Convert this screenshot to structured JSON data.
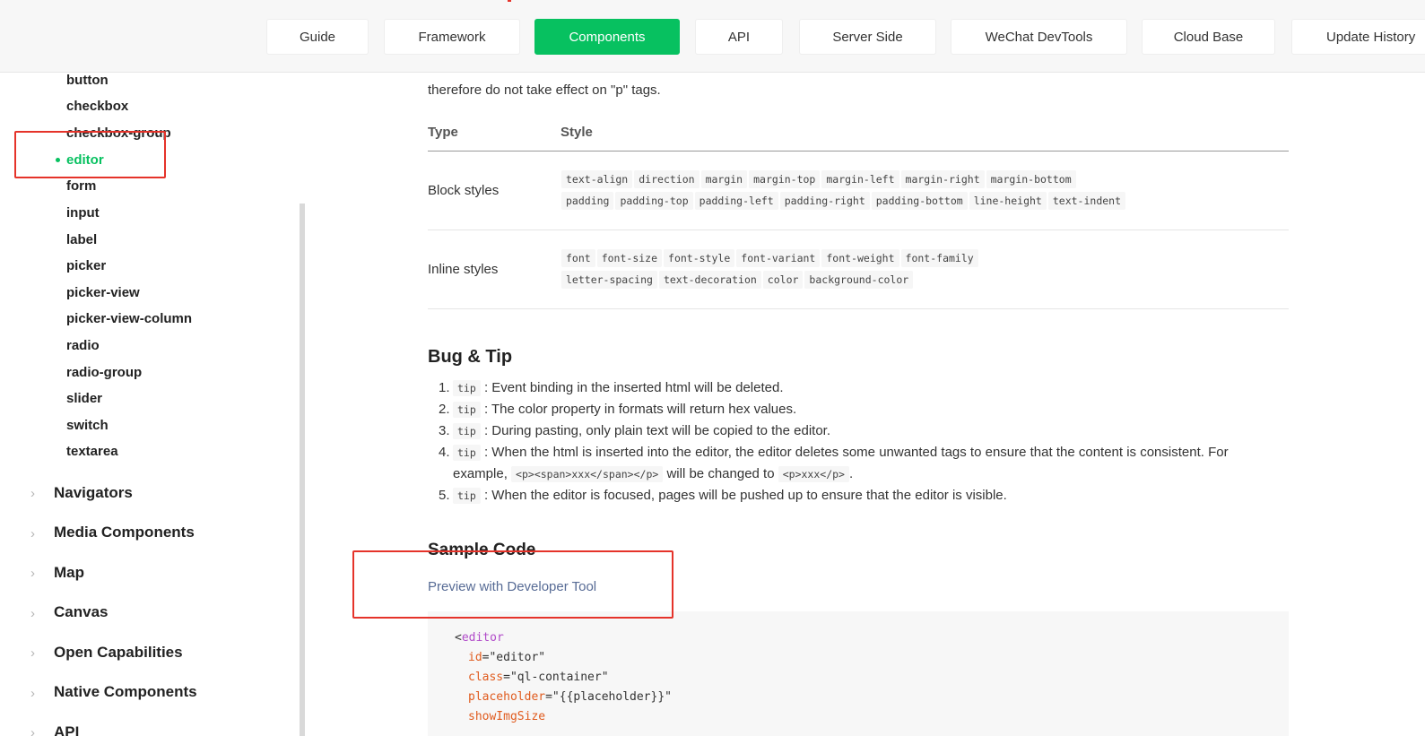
{
  "topnav": {
    "items": [
      {
        "label": "Guide"
      },
      {
        "label": "Framework"
      },
      {
        "label": "Components"
      },
      {
        "label": "API"
      },
      {
        "label": "Server Side"
      },
      {
        "label": "WeChat DevTools"
      },
      {
        "label": "Cloud Base"
      },
      {
        "label": "Update History"
      }
    ],
    "active": "Components"
  },
  "sidebar": {
    "form_items": [
      {
        "label": "button"
      },
      {
        "label": "checkbox"
      },
      {
        "label": "checkbox-group"
      },
      {
        "label": "editor"
      },
      {
        "label": "form"
      },
      {
        "label": "input"
      },
      {
        "label": "label"
      },
      {
        "label": "picker"
      },
      {
        "label": "picker-view"
      },
      {
        "label": "picker-view-column"
      },
      {
        "label": "radio"
      },
      {
        "label": "radio-group"
      },
      {
        "label": "slider"
      },
      {
        "label": "switch"
      },
      {
        "label": "textarea"
      }
    ],
    "active_item": "editor",
    "groups": [
      {
        "label": "Navigators",
        "chevron": "›"
      },
      {
        "label": "Media Components",
        "chevron": "›"
      },
      {
        "label": "Map",
        "chevron": "›"
      },
      {
        "label": "Canvas",
        "chevron": "›"
      },
      {
        "label": "Open Capabilities",
        "chevron": "›"
      },
      {
        "label": "Native Components",
        "chevron": "›"
      },
      {
        "label": "API",
        "chevron": "›"
      }
    ]
  },
  "content": {
    "cut_off_text": "... therefore do not take effect on ... tags.",
    "intro_line": "therefore do not take effect on \"p\" tags.",
    "table": {
      "headers": [
        "Type",
        "Style"
      ],
      "rows": [
        {
          "type": "Block styles",
          "line1": [
            "text-align",
            "direction",
            "margin",
            "margin-top",
            "margin-left",
            "margin-right",
            "margin-bottom"
          ],
          "line2": [
            "padding",
            "padding-top",
            "padding-left",
            "padding-right",
            "padding-bottom",
            "line-height",
            "text-indent"
          ]
        },
        {
          "type": "Inline styles",
          "line1": [
            "font",
            "font-size",
            "font-style",
            "font-variant",
            "font-weight",
            "font-family"
          ],
          "line2": [
            "letter-spacing",
            "text-decoration",
            "color",
            "background-color"
          ]
        }
      ]
    },
    "bug_tip": {
      "title": "Bug & Tip",
      "items": [
        {
          "num": "1.",
          "tag": "tip",
          "text": ": Event binding in the inserted html will be deleted."
        },
        {
          "num": "2.",
          "tag": "tip",
          "text": ": The color property in formats will return hex values."
        },
        {
          "num": "3.",
          "tag": "tip",
          "text": ": During pasting, only plain text will be copied to the editor."
        },
        {
          "num": "4.",
          "tag": "tip",
          "text": ": When the html is inserted into the editor, the editor deletes some unwanted tags to ensure that the content is consistent. For"
        },
        {
          "num": "5.",
          "tag": "tip",
          "text": ": When the editor is focused, pages will be pushed up to ensure that the editor is visible."
        }
      ],
      "item4_cont_prefix": "example,",
      "item4_code1": "<p><span>xxx</span></p>",
      "item4_mid": "will be changed to",
      "item4_code2": "<p>xxx</p>",
      "item4_end": "."
    },
    "sample": {
      "title": "Sample Code",
      "link": "Preview with Developer Tool"
    },
    "code": {
      "open": "<",
      "tag": "editor",
      "attrs": [
        {
          "name": "id",
          "eq": "=",
          "value": "\"editor\""
        },
        {
          "name": "class",
          "eq": "=",
          "value": "\"ql-container\""
        },
        {
          "name": "placeholder",
          "eq": "=",
          "value": "\"{{placeholder}}\""
        },
        {
          "name": "showImgSize",
          "eq": "",
          "value": ""
        }
      ]
    }
  },
  "colors": {
    "accent": "#07c160",
    "link": "#576b95",
    "highlight": "#e5332a"
  },
  "icons": {
    "active_bullet": "dot-icon",
    "group_chevron": "chevron-right-icon"
  }
}
